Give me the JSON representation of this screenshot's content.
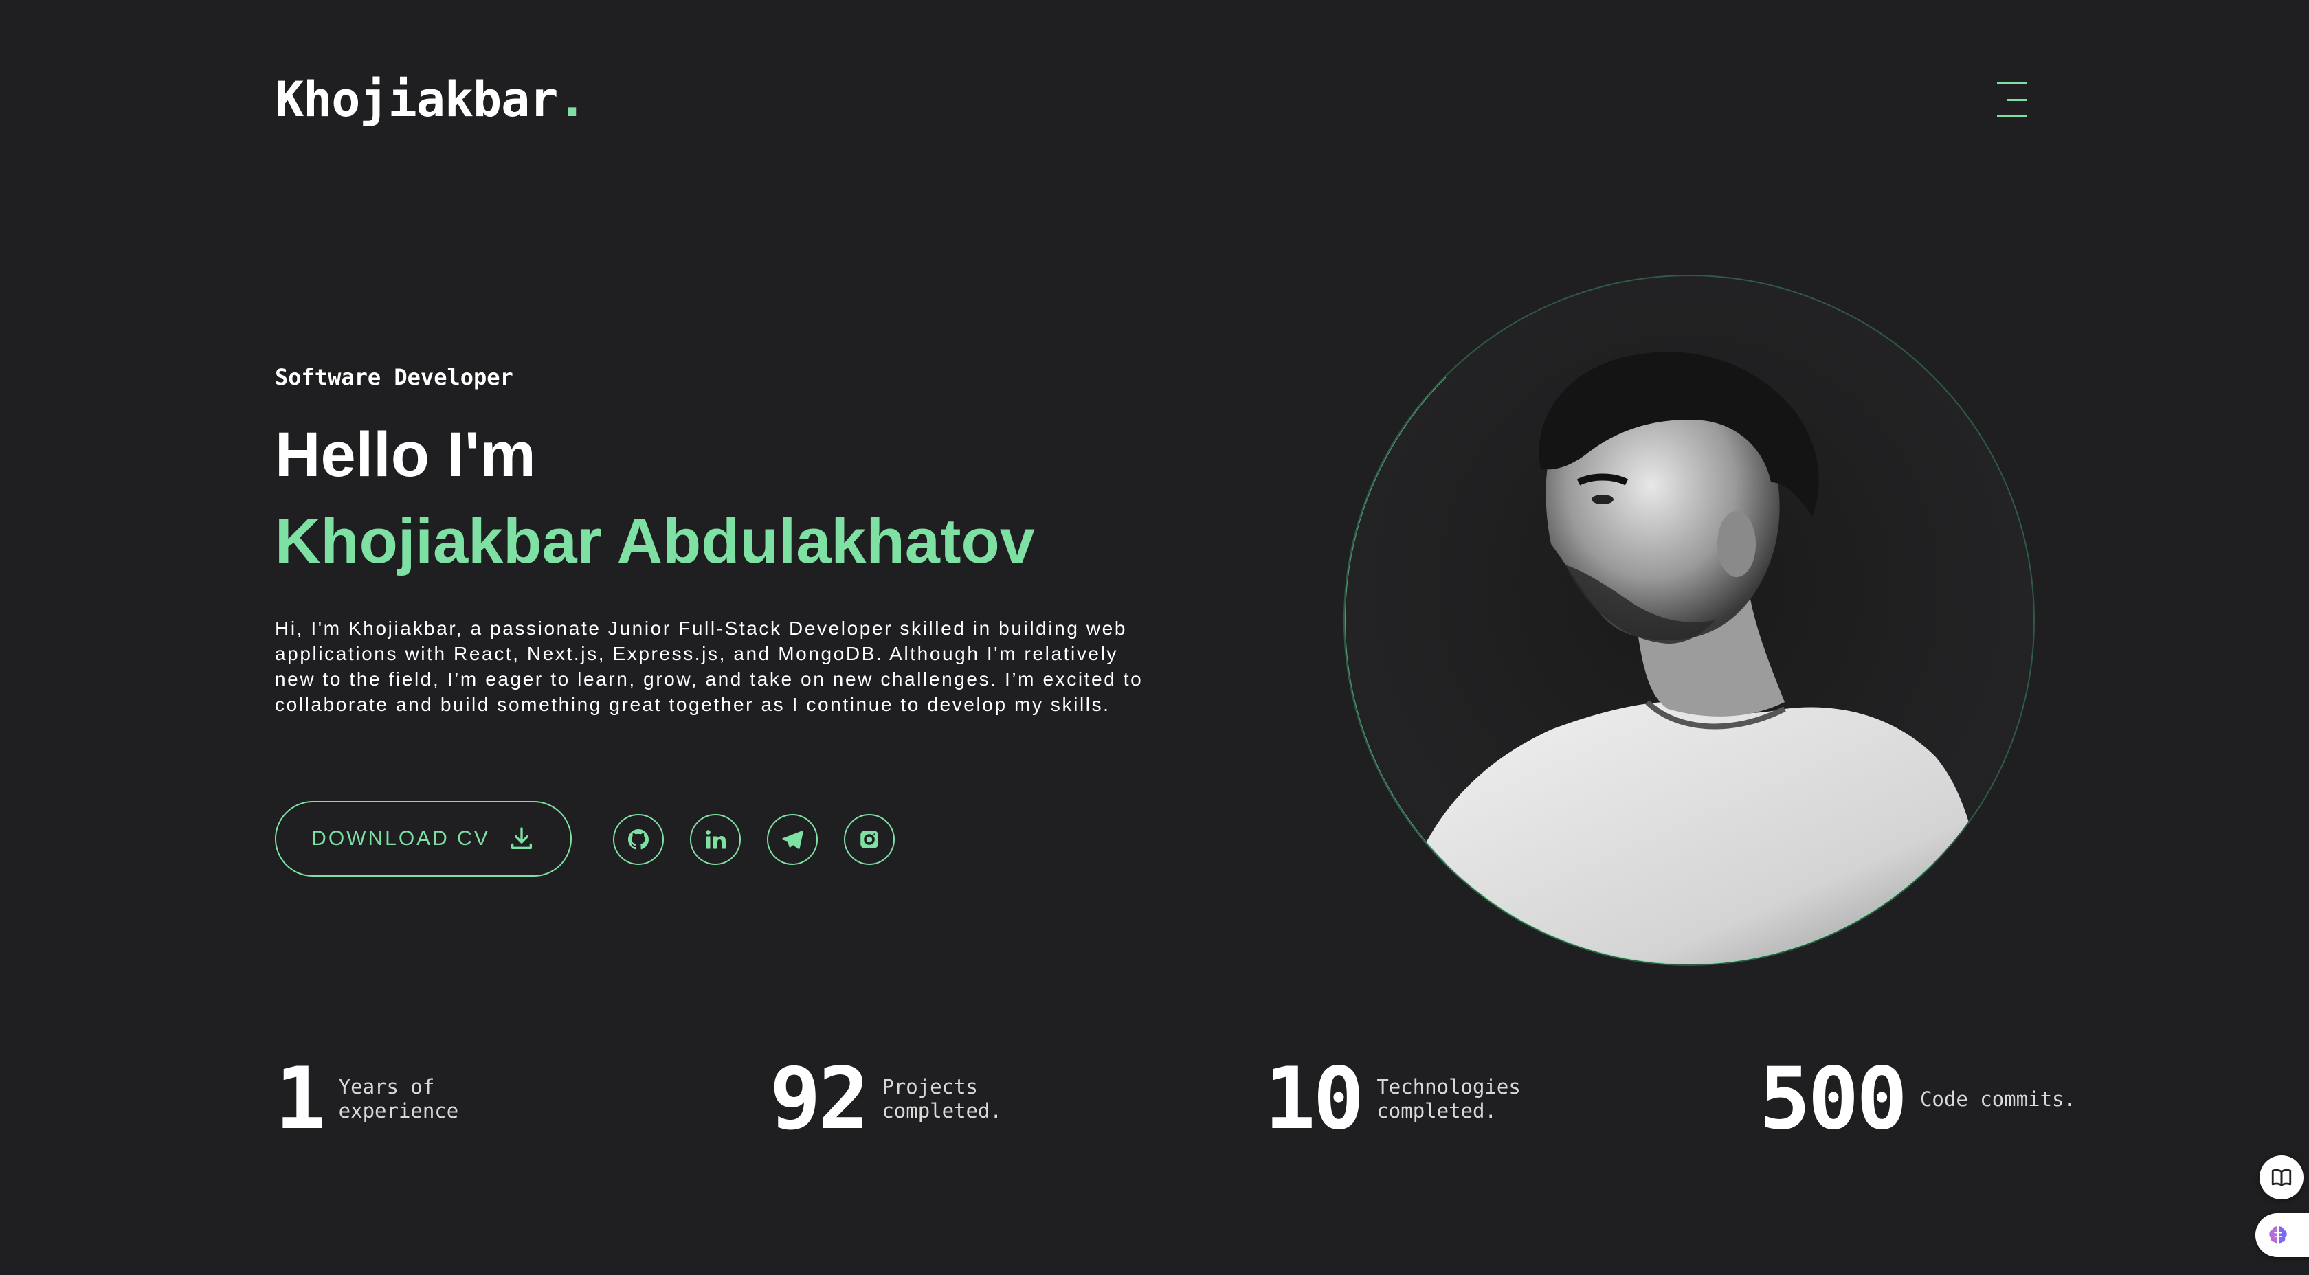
{
  "header": {
    "logo_text": "Khojiakbar",
    "logo_dot": ".",
    "menu_icon": "hamburger-menu-icon"
  },
  "hero": {
    "subtitle": "Software Developer",
    "greeting": "Hello I'm",
    "name": "Khojiakbar Abdulakhatov",
    "bio": "Hi, I'm Khojiakbar, a passionate Junior Full-Stack Developer skilled in building web applications with React, Next.js, Express.js, and MongoDB. Although I'm relatively new to the field, I’m eager to learn, grow, and take on new challenges. I’m excited to collaborate and build something great together as I continue to develop my skills.",
    "cv_button": "DOWNLOAD CV",
    "socials": [
      "github-icon",
      "linkedin-icon",
      "telegram-icon",
      "instagram-icon"
    ]
  },
  "stats": [
    {
      "value": "1",
      "label": "Years of experience"
    },
    {
      "value": "92",
      "label": "Projects completed."
    },
    {
      "value": "10",
      "label": "Technologies completed."
    },
    {
      "value": "500",
      "label": "Code commits."
    }
  ],
  "floating": [
    "book-icon",
    "brain-icon"
  ],
  "colors": {
    "background": "#1f1f21",
    "accent": "#7ee0a3",
    "text": "#ffffff"
  }
}
